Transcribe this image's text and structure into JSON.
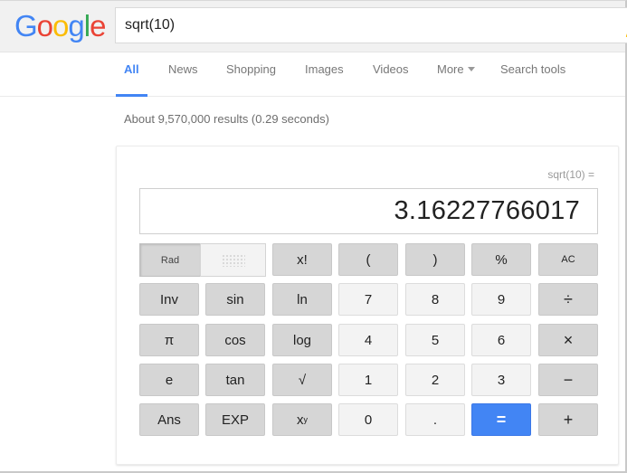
{
  "header": {
    "logo": [
      "G",
      "o",
      "o",
      "g",
      "l",
      "e"
    ],
    "search_value": "sqrt(10)"
  },
  "tabs": [
    {
      "label": "All",
      "active": true
    },
    {
      "label": "News"
    },
    {
      "label": "Shopping"
    },
    {
      "label": "Images"
    },
    {
      "label": "Videos"
    },
    {
      "label": "More"
    },
    {
      "label": "Search tools"
    }
  ],
  "results_stats": "About 9,570,000 results (0.29 seconds)",
  "calculator": {
    "expression": "sqrt(10) =",
    "result": "3.16227766017",
    "mode": {
      "rad": "Rad",
      "deg": "Deg"
    },
    "buttons": {
      "fact": "x!",
      "lparen": "(",
      "rparen": ")",
      "percent": "%",
      "ac": "AC",
      "inv": "Inv",
      "sin": "sin",
      "ln": "ln",
      "seven": "7",
      "eight": "8",
      "nine": "9",
      "divide": "÷",
      "pi": "π",
      "cos": "cos",
      "log": "log",
      "four": "4",
      "five": "5",
      "six": "6",
      "multiply": "×",
      "e": "e",
      "tan": "tan",
      "sqrt": "√",
      "one": "1",
      "two": "2",
      "three": "3",
      "minus": "−",
      "ans": "Ans",
      "exp": "EXP",
      "pow_base": "x",
      "pow_exp": "y",
      "zero": "0",
      "dot": ".",
      "equals": "=",
      "plus": "+"
    }
  },
  "colors": {
    "accent": "#4285f4",
    "key_dark": "#d6d6d6",
    "key_light": "#f3f3f3"
  }
}
